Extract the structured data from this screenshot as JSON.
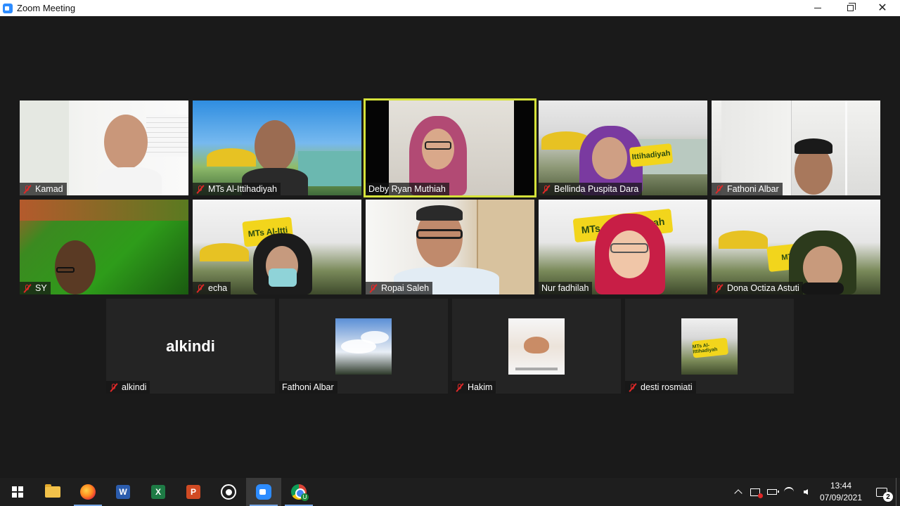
{
  "window": {
    "title": "Zoom Meeting",
    "icon": "zoom-icon",
    "minimize_icon": "minimize-icon",
    "restore_icon": "restore-icon",
    "close_icon": "close-icon"
  },
  "participants": [
    {
      "name": "Kamad",
      "muted": true,
      "active": false
    },
    {
      "name": "MTs Al-Ittihadiyah",
      "muted": true,
      "active": false
    },
    {
      "name": "Deby Ryan Muthiah",
      "muted": false,
      "active": true
    },
    {
      "name": "Bellinda Puspita Dara",
      "muted": true,
      "active": false
    },
    {
      "name": "Fathoni Albar",
      "muted": true,
      "active": false
    },
    {
      "name": "SY",
      "muted": true,
      "active": false
    },
    {
      "name": "echa",
      "muted": true,
      "active": false
    },
    {
      "name": "Ropai Saleh",
      "muted": true,
      "active": false
    },
    {
      "name": "Nur fadhilah",
      "muted": false,
      "active": false
    },
    {
      "name": "Dona Octiza Astuti",
      "muted": true,
      "active": false
    },
    {
      "name": "alkindi",
      "muted": true,
      "active": false,
      "display_text": "alkindi"
    },
    {
      "name": "Fathoni Albar",
      "muted": false,
      "active": false
    },
    {
      "name": "Hakim",
      "muted": true,
      "active": false
    },
    {
      "name": "desti rosmiati",
      "muted": true,
      "active": false
    }
  ],
  "taskbar": {
    "apps": [
      "start-icon",
      "file-explorer-icon",
      "firefox-icon",
      "word-icon",
      "excel-icon",
      "powerpoint-icon",
      "whatsapp-icon",
      "zoom-icon",
      "chrome-icon"
    ],
    "active_app": "zoom-icon",
    "letters": {
      "word": "W",
      "excel": "X",
      "ppt": "P",
      "chrome_badge": "U"
    },
    "clock_time": "13:44",
    "clock_date": "07/09/2021",
    "notification_count": "2"
  }
}
